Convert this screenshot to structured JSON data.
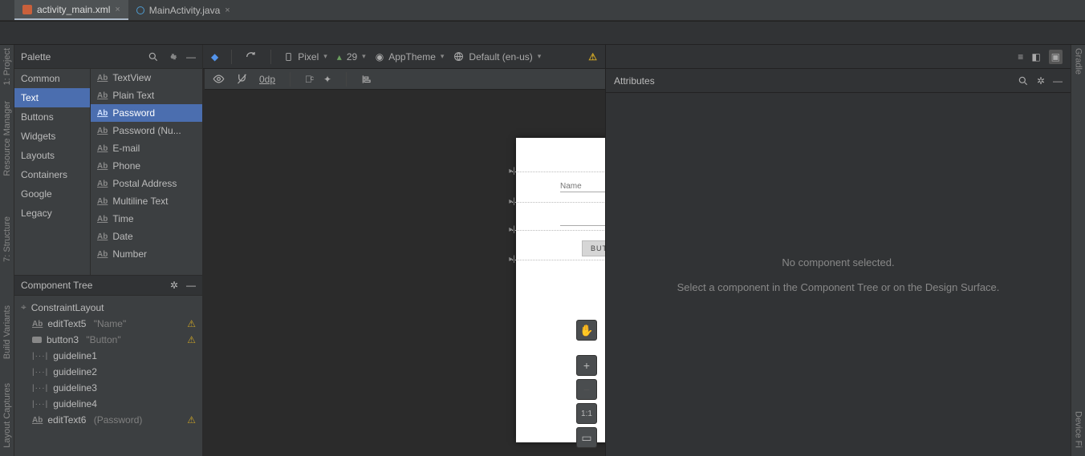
{
  "tabs": [
    {
      "label": "activity_main.xml",
      "active": true,
      "type": "xml"
    },
    {
      "label": "MainActivity.java",
      "active": false,
      "type": "java"
    }
  ],
  "rails": {
    "left_top": [
      "1: Project",
      "Resource Manager"
    ],
    "left_mid": [
      "7: Structure"
    ],
    "left_bottom": [
      "Build Variants",
      "Layout Captures"
    ],
    "right": [
      "Gradle",
      "Device Fi"
    ]
  },
  "palette": {
    "title": "Palette",
    "categories": [
      "Common",
      "Text",
      "Buttons",
      "Widgets",
      "Layouts",
      "Containers",
      "Google",
      "Legacy"
    ],
    "selected_category_index": 1,
    "items": [
      "TextView",
      "Plain Text",
      "Password",
      "Password (Nu...",
      "E-mail",
      "Phone",
      "Postal Address",
      "Multiline Text",
      "Time",
      "Date",
      "Number"
    ],
    "selected_item_index": 2
  },
  "component_tree": {
    "title": "Component Tree",
    "root": "ConstraintLayout",
    "children": [
      {
        "icon": "ab",
        "id": "editText5",
        "hint": "\"Name\"",
        "warn": true
      },
      {
        "icon": "btn",
        "id": "button3",
        "hint": "\"Button\"",
        "warn": true
      },
      {
        "icon": "gl",
        "id": "guideline1"
      },
      {
        "icon": "gl",
        "id": "guideline2"
      },
      {
        "icon": "gl",
        "id": "guideline3"
      },
      {
        "icon": "gl",
        "id": "guideline4"
      },
      {
        "icon": "ab",
        "id": "editText6",
        "hint": "(Password)",
        "warn": true
      }
    ]
  },
  "design_toolbar": {
    "device": "Pixel",
    "api": "29",
    "theme": "AppTheme",
    "locale": "Default (en-us)"
  },
  "subtoolbar": {
    "dp": "0dp"
  },
  "device_preview": {
    "input1_placeholder": "Name",
    "button_label": "BUTTON"
  },
  "zoom_11": "1:1",
  "attributes": {
    "title": "Attributes",
    "msg1": "No component selected.",
    "msg2": "Select a component in the Component Tree or on the Design Surface."
  }
}
